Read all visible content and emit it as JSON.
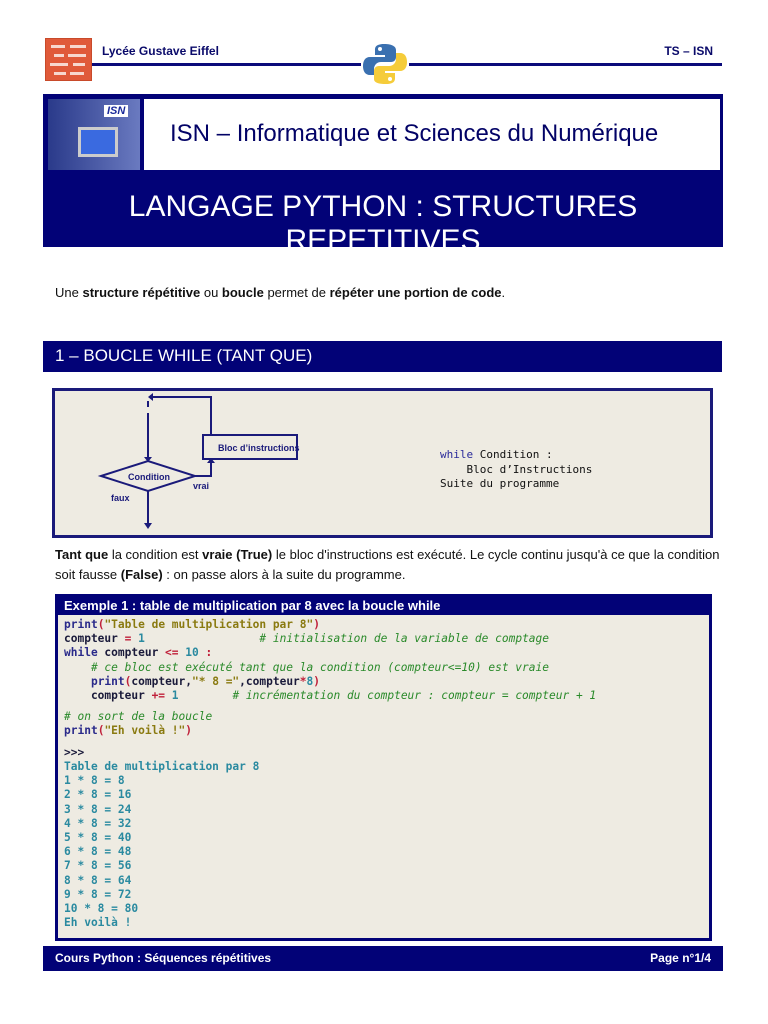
{
  "header": {
    "school": "Lycée Gustave Eiffel",
    "class": "TS – ISN",
    "badge": "ISN"
  },
  "title": {
    "subtitle": "ISN – Informatique et Sciences du Numérique",
    "main": "LANGAGE PYTHON : STRUCTURES REPETITIVES"
  },
  "intro": {
    "p1": "Une ",
    "b1": "structure répétitive",
    "p2": " ou ",
    "b2": "boucle",
    "p3": " permet de ",
    "b3": "répéter une portion de code",
    "p4": "."
  },
  "section1": {
    "title": "1 – BOUCLE WHILE (TANT QUE)"
  },
  "diagram": {
    "block": "Bloc d’instructions",
    "condition": "Condition",
    "true": "vrai",
    "false": "faux",
    "code_kw": "while",
    "code_l1": " Condition :",
    "code_l2": "    Bloc d’Instructions",
    "code_l3": "Suite du programme"
  },
  "paragraph": {
    "b1": "Tant que",
    "t1": " la condition est ",
    "b2": "vraie (True)",
    "t2": " le bloc d'instructions est exécuté. Le cycle continu jusqu'à ce que la condition soit fausse ",
    "b3": "(False)",
    "t3": " : on passe alors à la suite du programme."
  },
  "example": {
    "title": "Exemple 1 : table de multiplication par 8 avec la boucle while",
    "prompt": ">>>",
    "output": [
      "Table de multiplication par 8",
      "1 * 8 = 8",
      "2 * 8 = 16",
      "3 * 8 = 24",
      "4 * 8 = 32",
      "5 * 8 = 40",
      "6 * 8 = 48",
      "7 * 8 = 56",
      "8 * 8 = 64",
      "9 * 8 = 72",
      "10 * 8 = 80",
      "Eh voilà !"
    ]
  },
  "footer": {
    "left": "Cours Python : Séquences répétitives",
    "right": "Page n°1/4"
  },
  "colors": {
    "navy": "#020277",
    "code_bg": "#eeebe2",
    "logo": "#e05a3a"
  }
}
